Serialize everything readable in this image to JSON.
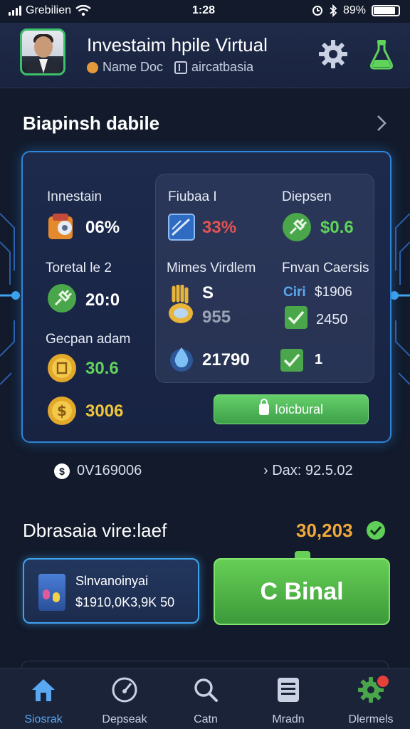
{
  "status_bar": {
    "carrier": "Grebilien",
    "time": "1:28",
    "battery": "89%"
  },
  "header": {
    "title": "Investaim hpile  Virtual",
    "subtitle_left": "Name Doc",
    "subtitle_right": "aircatbasia"
  },
  "section1": {
    "title": "Biapinsh dabile",
    "stats": {
      "left_top_label": "Innestain",
      "left_top_value": "06%",
      "mid_top_label": "Fiubaa I",
      "mid_top_value": "33%",
      "right_top_label": "Diepsen",
      "right_top_value": "$0.6",
      "left_2_label": "Toretal le 2",
      "left_2_value": "20:0",
      "mid_2_label": "Mimes Virdlem",
      "mid_2_value_a": "S",
      "mid_2_value_b": "955",
      "right_2_label": "Fnvan Caersis",
      "right_2_value_a_prefix": "Ciri",
      "right_2_value_a": "$1906",
      "right_2_value_b": "2450",
      "left_3_label": "Gecpan adam",
      "left_3_value": "30.6",
      "left_4_value": "3006",
      "mid_3_value": "21790",
      "right_3_value": "1"
    },
    "action_button": "Ioicbural",
    "footer_left": "0V169006",
    "footer_right": "Dax: 92.5.02"
  },
  "section2": {
    "title": "Dbrasaia vire:laef",
    "total": "30,203",
    "account_name": "Slnvanoinyai",
    "account_value": "$1910,0K3,9K 50",
    "primary_button": "C Binal"
  },
  "nav": {
    "items": [
      {
        "label": "Siosrak",
        "icon": "home-icon"
      },
      {
        "label": "Depseak",
        "icon": "gauge-icon"
      },
      {
        "label": "Catn",
        "icon": "search-icon"
      },
      {
        "label": "Mradn",
        "icon": "document-icon"
      },
      {
        "label": "Dlermels",
        "icon": "gear-badge-icon"
      }
    ]
  },
  "colors": {
    "accent_blue": "#2f84d6",
    "accent_green": "#5fd35a",
    "accent_orange": "#f0a93a",
    "badge_red": "#e5403a"
  }
}
